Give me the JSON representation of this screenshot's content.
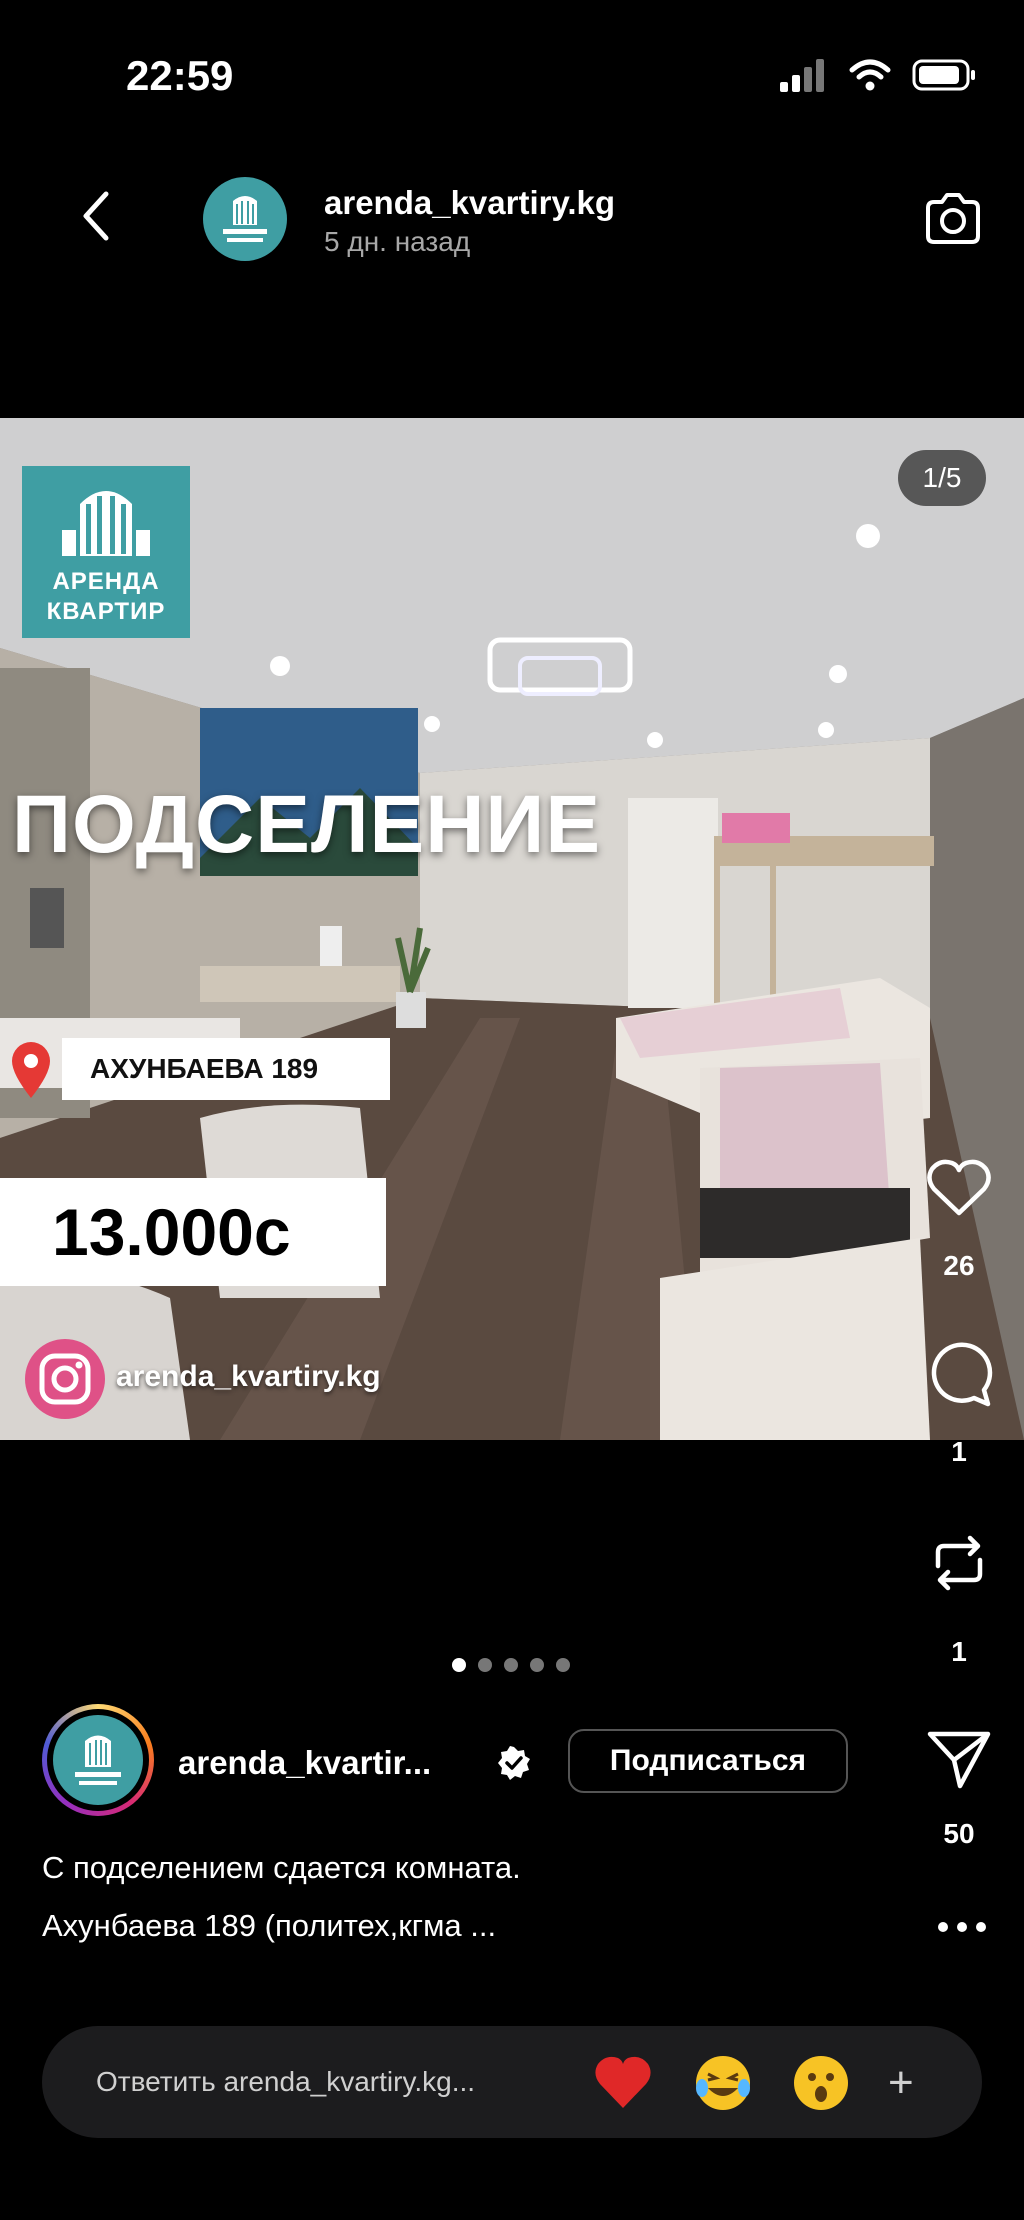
{
  "status_bar": {
    "time": "22:59"
  },
  "header": {
    "username": "arenda_kvartiry.kg",
    "time_ago": "5 дн. назад"
  },
  "post": {
    "counter": "1/5",
    "brand_line1": "АРЕНДА",
    "brand_line2": "КВАРТИР",
    "headline": "ПОДСЕЛЕНИЕ",
    "address": "АХУНБАЕВА 189",
    "price": "13.000с",
    "watermark": "arenda_kvartiry.kg",
    "slide_count": 5,
    "active_slide": 1
  },
  "actions": {
    "likes": "26",
    "comments": "1",
    "reposts": "1",
    "shares": "50"
  },
  "author": {
    "name": "arenda_kvartir...",
    "follow_label": "Подписаться"
  },
  "caption": {
    "line1": "С подселением сдается комната.",
    "line2": "Ахунбаева 189 (политех,кгма ..."
  },
  "reply": {
    "placeholder": "Ответить arenda_kvartiry.kg..."
  },
  "colors": {
    "brand_teal": "#3f9ea3",
    "pin_red": "#e53935",
    "background": "#000000"
  }
}
